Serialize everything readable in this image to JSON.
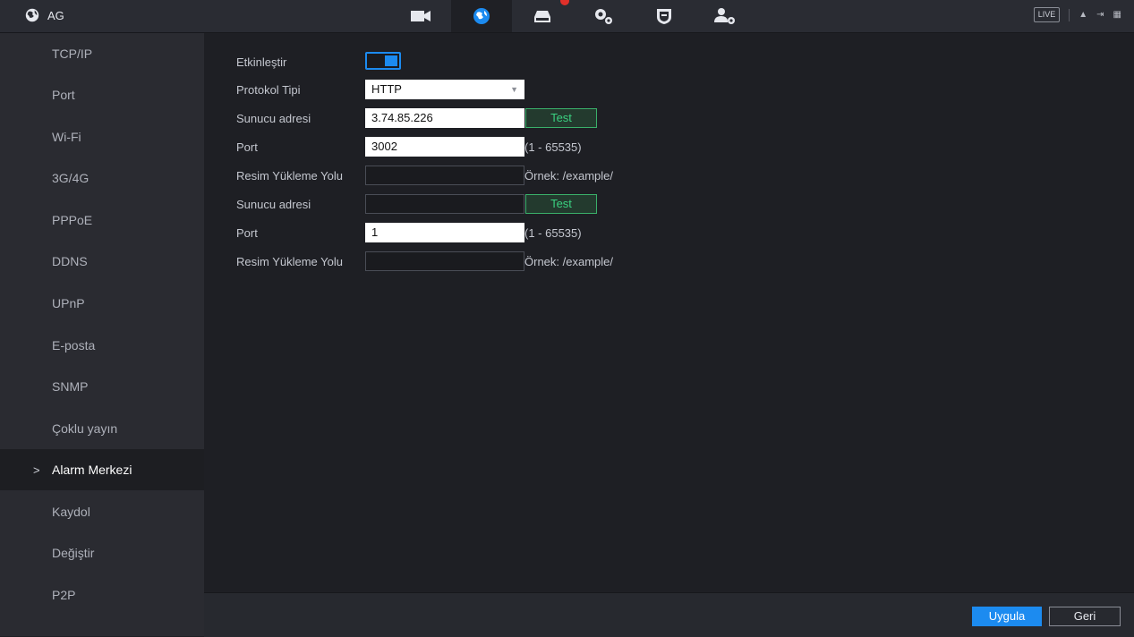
{
  "app": {
    "title": "AG",
    "live_label": "LIVE"
  },
  "topbar_icons": [
    {
      "name": "camera-icon",
      "active": false
    },
    {
      "name": "network-globe-icon",
      "active": true
    },
    {
      "name": "storage-icon",
      "active": false
    },
    {
      "name": "settings-gears-icon",
      "active": false
    },
    {
      "name": "security-shield-icon",
      "active": false
    },
    {
      "name": "account-settings-icon",
      "active": false
    }
  ],
  "sidebar": {
    "items": [
      {
        "label": "TCP/IP"
      },
      {
        "label": "Port"
      },
      {
        "label": "Wi-Fi"
      },
      {
        "label": "3G/4G"
      },
      {
        "label": "PPPoE"
      },
      {
        "label": "DDNS"
      },
      {
        "label": "UPnP"
      },
      {
        "label": "E-posta"
      },
      {
        "label": "SNMP"
      },
      {
        "label": "Çoklu yayın"
      },
      {
        "label": "Alarm Merkezi",
        "active": true
      },
      {
        "label": "Kaydol"
      },
      {
        "label": "Değiştir"
      },
      {
        "label": "P2P"
      }
    ],
    "active_marker": ">"
  },
  "form": {
    "enable_label": "Etkinleştir",
    "enable_on": true,
    "protocol_label": "Protokol Tipi",
    "protocol_value": "HTTP",
    "server1_label": "Sunucu adresi",
    "server1_value": "3.74.85.226",
    "test1_label": "Test",
    "port1_label": "Port",
    "port1_value": "3002",
    "port1_hint": "(1 - 65535)",
    "path1_label": "Resim Yükleme Yolu",
    "path1_value": "",
    "path1_hint": "Örnek: /example/",
    "server2_label": "Sunucu adresi",
    "server2_value": "",
    "test2_label": "Test",
    "port2_label": "Port",
    "port2_value": "1",
    "port2_hint": "(1 - 65535)",
    "path2_label": "Resim Yükleme Yolu",
    "path2_value": "",
    "path2_hint": "Örnek: /example/"
  },
  "footer": {
    "apply_label": "Uygula",
    "back_label": "Geri"
  },
  "colors": {
    "accent": "#1c8bf0",
    "test_green": "#3ab06a"
  }
}
